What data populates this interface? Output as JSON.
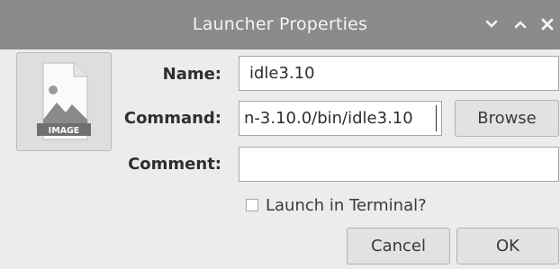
{
  "window": {
    "title": "Launcher Properties",
    "controls": {
      "minimize": "minimize",
      "maximize": "maximize",
      "close": "close"
    }
  },
  "icon_button": {
    "icon": "image-file-icon",
    "badge_text": "IMAGE"
  },
  "form": {
    "name_label": "Name:",
    "name_value": "idle3.10",
    "command_label": "Command:",
    "command_value": "n-3.10.0/bin/idle3.10",
    "comment_label": "Comment:",
    "comment_value": "",
    "browse_label": "Browse",
    "terminal_label": "Launch in Terminal?",
    "terminal_checked": false
  },
  "buttons": {
    "cancel_label": "Cancel",
    "ok_label": "OK"
  },
  "colors": {
    "titlebar": "#8b8b8b",
    "title_text": "#f4f4f4",
    "background": "#ececec",
    "field_background": "#ffffff"
  }
}
